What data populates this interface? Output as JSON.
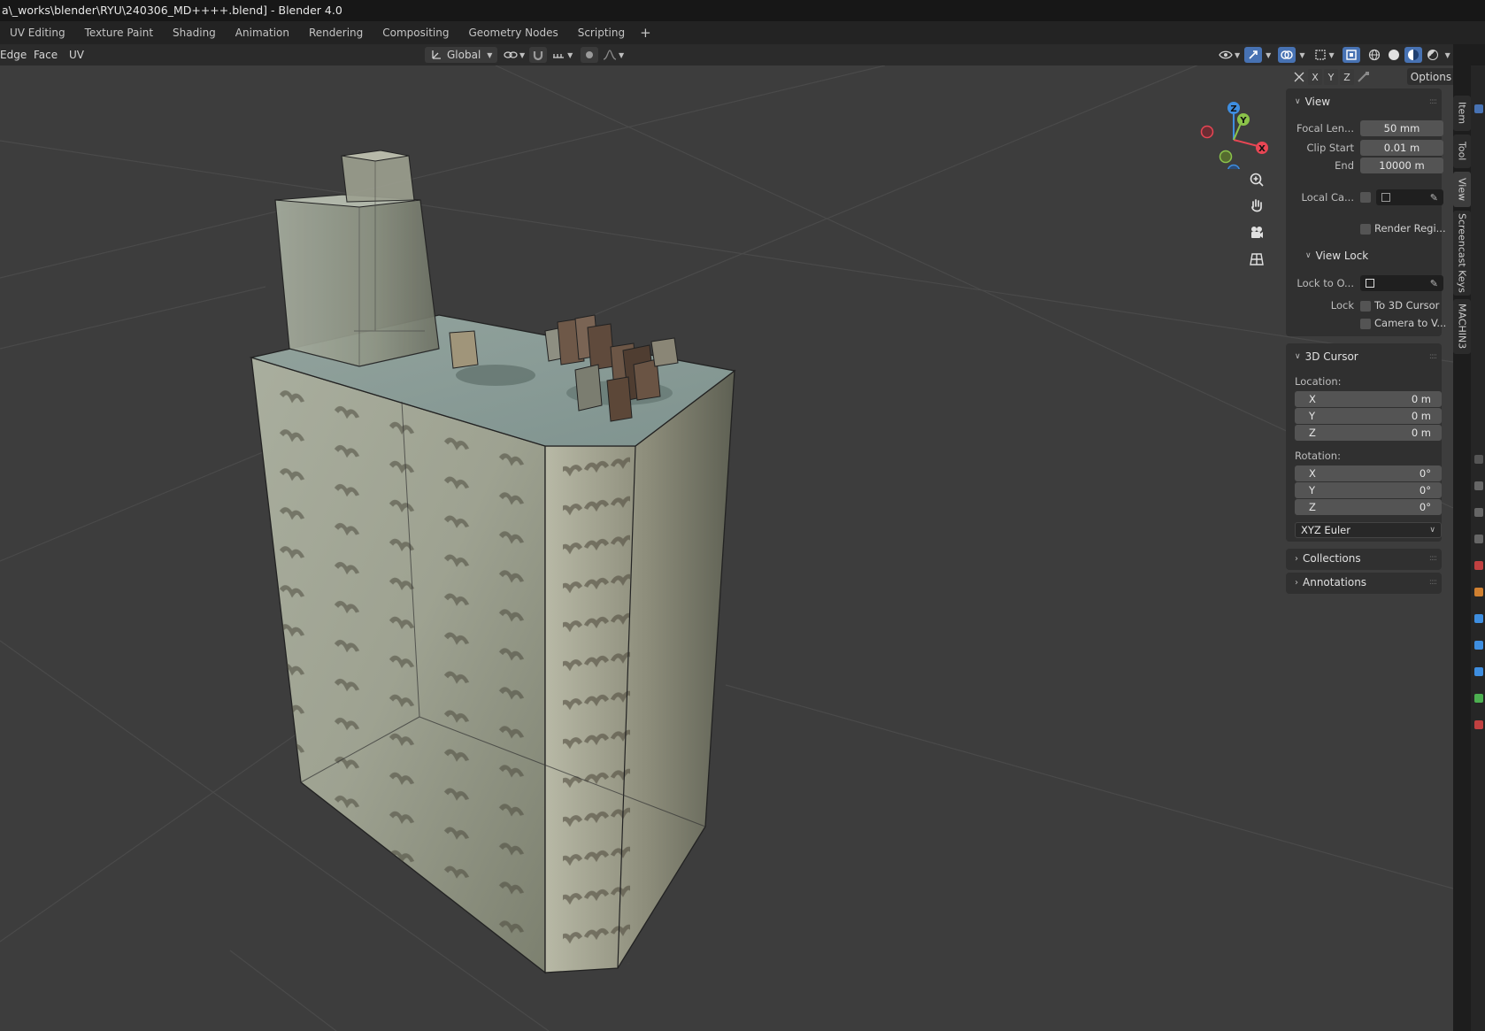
{
  "window": {
    "title": "a\\_works\\blender\\RYU\\240306_MD++++.blend] - Blender 4.0"
  },
  "workspaces": [
    "UV Editing",
    "Texture Paint",
    "Shading",
    "Animation",
    "Rendering",
    "Compositing",
    "Geometry Nodes",
    "Scripting"
  ],
  "workspace_add": "+",
  "header": {
    "menus": [
      "Edge",
      "Face",
      "UV"
    ],
    "transform_orientation": "Global"
  },
  "viewport": {
    "axis_toggles": [
      "X",
      "Y",
      "Z"
    ],
    "options_label": "Options",
    "gizmo_labels": {
      "x": "X",
      "y": "Y",
      "z": "Z"
    }
  },
  "npanel": {
    "view": {
      "title": "View",
      "focal_length_label": "Focal Len...",
      "focal_length_value": "50 mm",
      "clip_start_label": "Clip Start",
      "clip_start_value": "0.01 m",
      "clip_end_label": "End",
      "clip_end_value": "10000 m",
      "local_camera_label": "Local Ca...",
      "render_region_label": "Render Regi..."
    },
    "view_lock": {
      "title": "View Lock",
      "lock_to_object_label": "Lock to O...",
      "lock_label": "Lock",
      "to_3d_cursor_label": "To 3D Cursor",
      "camera_to_view_label": "Camera to V..."
    },
    "cursor": {
      "title": "3D Cursor",
      "location_label": "Location:",
      "location": [
        {
          "axis": "X",
          "value": "0 m"
        },
        {
          "axis": "Y",
          "value": "0 m"
        },
        {
          "axis": "Z",
          "value": "0 m"
        }
      ],
      "rotation_label": "Rotation:",
      "rotation": [
        {
          "axis": "X",
          "value": "0°"
        },
        {
          "axis": "Y",
          "value": "0°"
        },
        {
          "axis": "Z",
          "value": "0°"
        }
      ],
      "rotation_mode": "XYZ Euler"
    },
    "collections_title": "Collections",
    "annotations_title": "Annotations"
  },
  "sidebar_tabs": [
    "Item",
    "Tool",
    "View",
    "Screencast Keys",
    "MACHIN3"
  ],
  "colors": {
    "accent_blue": "#4772b3",
    "axis_x": "#e84654",
    "axis_y": "#8bc34a",
    "axis_z": "#3e8ee0",
    "viewport_bg": "#3d3d3d"
  }
}
